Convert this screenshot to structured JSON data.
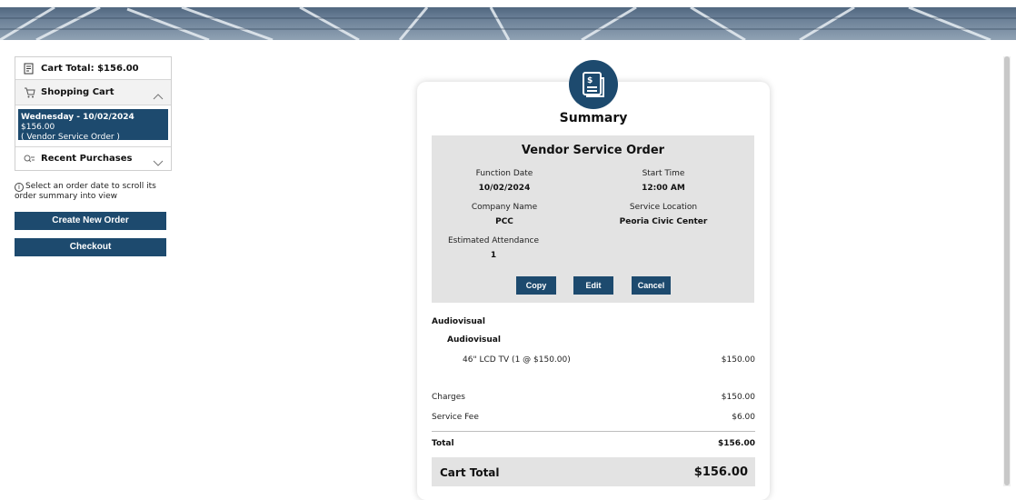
{
  "cart": {
    "total_label": "Cart Total: $156.00",
    "shopping_cart_label": "Shopping Cart",
    "selected_order_line1_bold": "Wednesday - 10/02/2024",
    "selected_order_line1_amount": " $156.00",
    "selected_order_line2": "( Vendor Service Order )",
    "recent_label": "Recent Purchases"
  },
  "info_text": "Select an order date to scroll its order summary into view",
  "buttons": {
    "create_new_order": "Create New Order",
    "checkout": "Checkout",
    "copy": "Copy",
    "edit": "Edit",
    "cancel": "Cancel"
  },
  "summary": {
    "title": "Summary",
    "order_title": "Vendor Service Order",
    "fields": {
      "function_date_label": "Function Date",
      "function_date_value": "10/02/2024",
      "start_time_label": "Start Time",
      "start_time_value": "12:00 AM",
      "company_name_label": "Company Name",
      "company_name_value": "PCC",
      "service_location_label": "Service Location",
      "service_location_value": "Peoria Civic Center",
      "attendance_label": "Estimated Attendance",
      "attendance_value": "1"
    },
    "category": "Audiovisual",
    "subcategory": "Audiovisual",
    "item_label": "46\" LCD TV (1 @ $150.00)",
    "item_amount": "$150.00",
    "charges_label": "Charges",
    "charges_amount": "$150.00",
    "service_fee_label": "Service Fee",
    "service_fee_amount": "$6.00",
    "total_label": "Total",
    "total_amount": "$156.00",
    "cart_total_label": "Cart Total",
    "cart_total_amount": "$156.00"
  },
  "colors": {
    "accent": "#1d4a6e",
    "panel_gray": "#e3e3e3"
  }
}
